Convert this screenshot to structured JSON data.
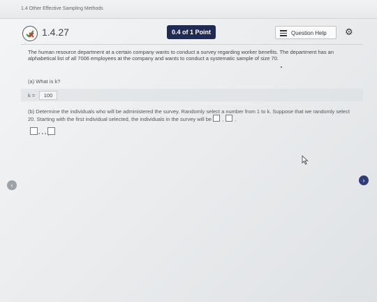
{
  "section_title": "1.4 Other Effective Sampling Methods",
  "question": {
    "number": "1.4.27",
    "points": "0.4 of 1 Point",
    "help_label": "Question Help",
    "icons": {
      "status": "partial-x-icon",
      "help": "list-icon",
      "settings": "gear-icon"
    }
  },
  "problem_text": "The human resource department at a certain company wants to conduct a survey regarding worker benefits. The department has an alphabetical list of all 7006 employees at the company and wants to conduct a systematic sample of size 70.",
  "part_a": {
    "prompt": "(a) What is k?",
    "k_label": "k =",
    "k_value": "100"
  },
  "part_b": {
    "prompt": "(b) Determine the individuals who will be administered the survey. Randomly select a number from 1 to k. Suppose that we randomly select 20. Starting with the first individual selected, the individuals in the survey will be",
    "separator": ",",
    "ellipsis": "...,"
  },
  "navigation": {
    "prev": "‹",
    "next": "›"
  },
  "colors": {
    "points_bg": "#1f2a55",
    "next_bg": "#2e3c7a",
    "badge_x": "#d33b2c",
    "badge_check": "#3a9a3a"
  }
}
